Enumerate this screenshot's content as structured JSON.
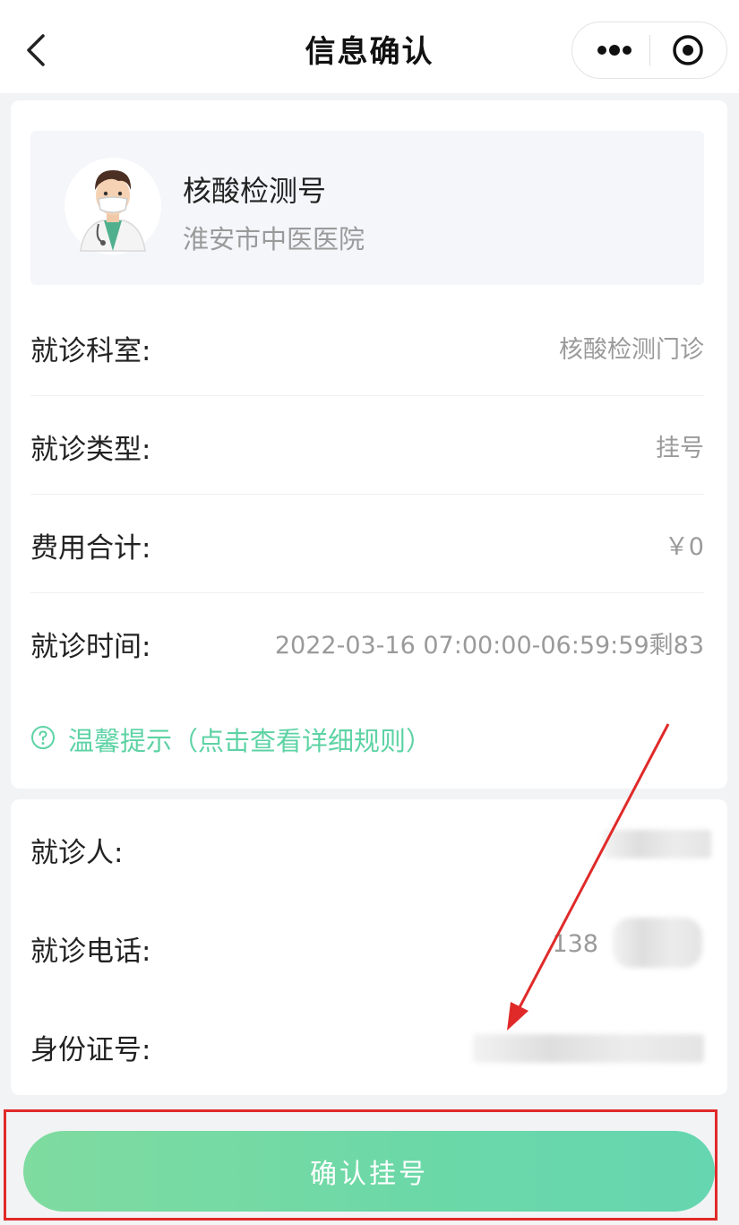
{
  "navbar": {
    "title": "信息确认",
    "back_icon": "chevron-left-icon",
    "more_icon": "more-dots-icon",
    "close_icon": "target-circle-icon"
  },
  "doctor": {
    "name": "核酸检测号",
    "hospital": "淮安市中医医院",
    "avatar_icon": "doctor-avatar-icon"
  },
  "details": [
    {
      "label": "就诊科室:",
      "value": "核酸检测门诊"
    },
    {
      "label": "就诊类型:",
      "value": "挂号"
    },
    {
      "label": "费用合计:",
      "value": "￥0"
    },
    {
      "label": "就诊时间:",
      "value": "2022-03-16 07:00:00-06:59:59剩83"
    }
  ],
  "tip": {
    "text": "温馨提示（点击查看详细规则）",
    "icon": "question-circle-icon"
  },
  "patient": [
    {
      "label": "就诊人:",
      "value": ""
    },
    {
      "label": "就诊电话:",
      "value": "138"
    },
    {
      "label": "身份证号:",
      "value": ""
    }
  ],
  "confirm": {
    "label": "确认挂号"
  },
  "colors": {
    "accent_green": "#5dd3a4",
    "button_green": "#6bd8a8",
    "annotation_red": "#e02a2a",
    "page_bg": "#f2f3f5"
  }
}
